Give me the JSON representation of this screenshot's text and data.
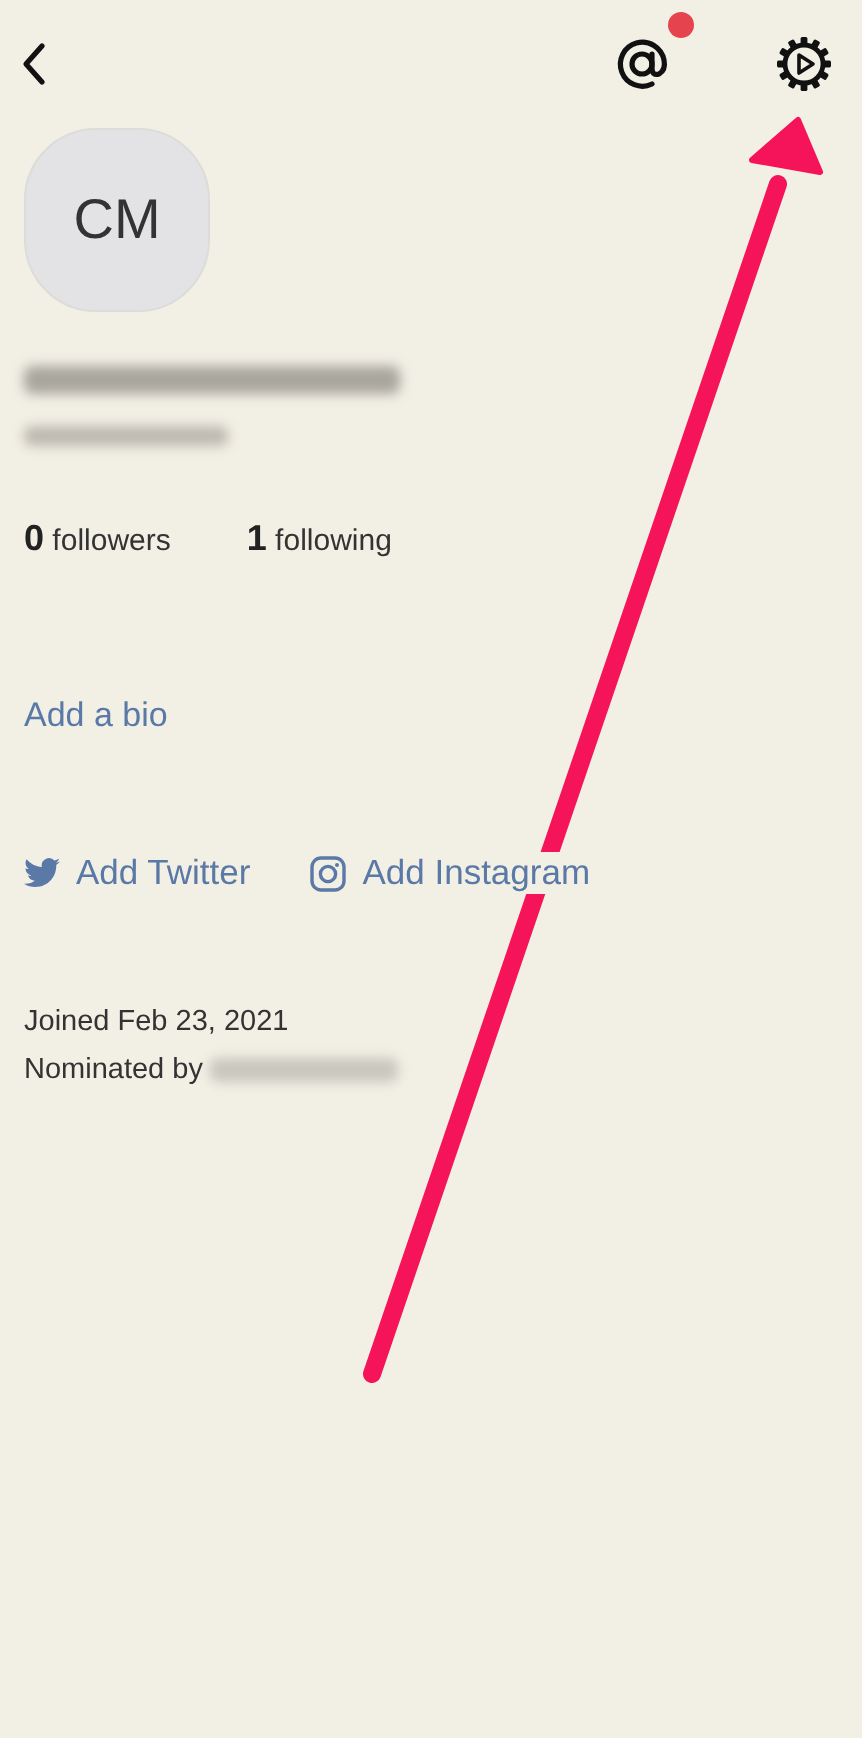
{
  "header": {
    "mention_badge": true
  },
  "profile": {
    "initials": "CM",
    "name_redacted": true,
    "handle_redacted": true
  },
  "stats": [
    {
      "count": "0",
      "label": "followers"
    },
    {
      "count": "1",
      "label": "following"
    }
  ],
  "bio_link": "Add a bio",
  "social_links": [
    {
      "kind": "twitter",
      "label": "Add Twitter"
    },
    {
      "kind": "instagram",
      "label": "Add Instagram"
    }
  ],
  "joined": "Joined Feb 23, 2021",
  "nominated": {
    "label": "Nominated by",
    "name_redacted": true
  },
  "annotation": {
    "kind": "arrow",
    "color": "#f5145a"
  }
}
